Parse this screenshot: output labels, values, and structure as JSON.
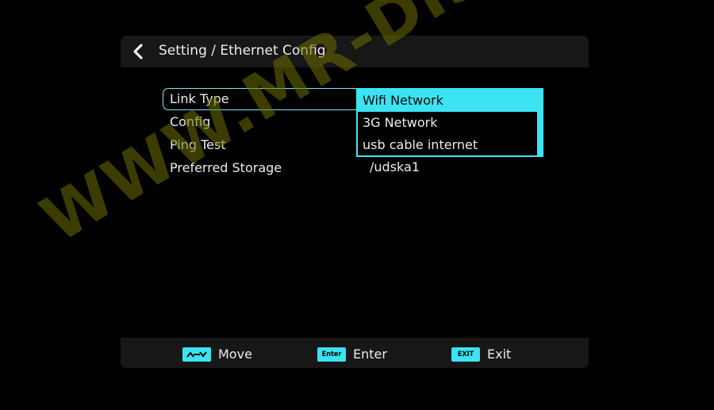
{
  "header": {
    "title": "Setting / Ethernet Config",
    "back_icon": "chevron-left-icon"
  },
  "menu": {
    "items": [
      {
        "label": "Link Type"
      },
      {
        "label": "Config"
      },
      {
        "label": "Ping Test"
      },
      {
        "label": "Preferred Storage"
      }
    ],
    "selected_index": 0
  },
  "values": {
    "preferred_storage": "/udska1"
  },
  "dropdown": {
    "options": [
      "Wifi Network",
      "3G Network",
      "usb cable internet"
    ],
    "selected": "Wifi Network"
  },
  "footer": {
    "hints": [
      {
        "key": "",
        "icon": "arrows-key-icon",
        "label": "Move"
      },
      {
        "key": "Enter",
        "icon": "enter-key-icon",
        "label": "Enter"
      },
      {
        "key": "EXIT",
        "icon": "exit-key-icon",
        "label": "Exit"
      }
    ]
  },
  "watermark": "WWW.MR-DISH.COM",
  "colors": {
    "accent": "#3ce4f3",
    "background": "#000000",
    "bar": "#171717",
    "text": "#ececec",
    "watermark": "#6e6e00"
  }
}
